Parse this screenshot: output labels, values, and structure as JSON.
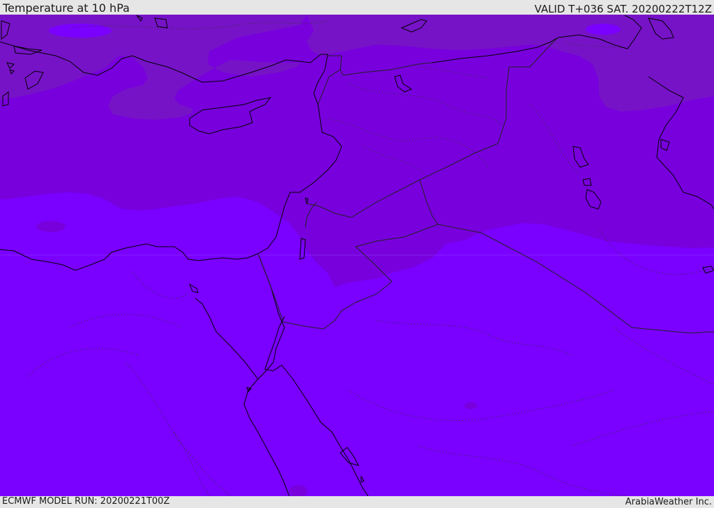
{
  "header": {
    "title": "Temperature at 10 hPa",
    "valid_time": "VALID T+036 SAT. 20200222T12Z"
  },
  "footer": {
    "model_run": "ECMWF MODEL RUN: 20200221T00Z",
    "credit": "ArabiaWeather Inc."
  },
  "map": {
    "colors": {
      "coldest_band": "#7613c7",
      "cold_band": "#7800dd",
      "base_band": "#7a00ff",
      "coastline": "#000000",
      "border": "#222222",
      "contour": "#333333"
    }
  }
}
